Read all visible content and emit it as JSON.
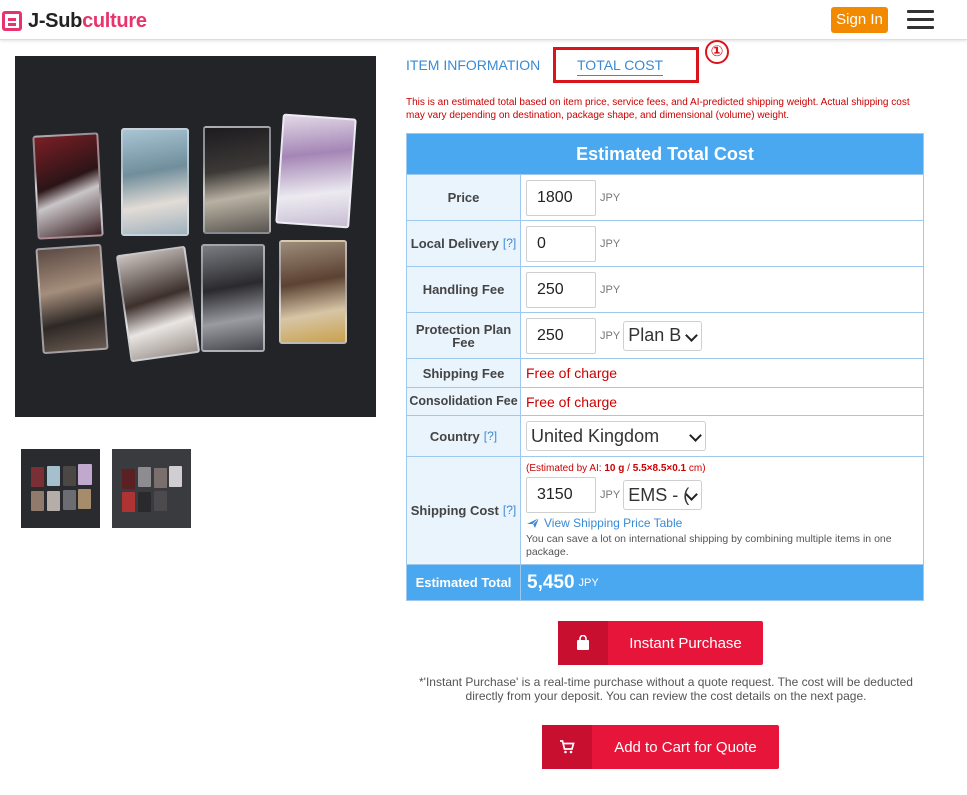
{
  "header": {
    "logo_prefix": "J-Sub",
    "logo_accent": "culture",
    "signin_label": "Sign In"
  },
  "tabs": {
    "info": "ITEM INFORMATION",
    "total": "TOTAL COST",
    "badge": "①"
  },
  "note": "This is an estimated total based on item price, service fees, and AI-predicted shipping weight. Actual shipping cost may vary depending on destination, package shape, and dimensional (volume) weight.",
  "table": {
    "title": "Estimated Total Cost",
    "help": "[?]",
    "unit": "JPY",
    "price": {
      "label": "Price",
      "value": "1800"
    },
    "local": {
      "label": "Local Delivery",
      "value": "0"
    },
    "handling": {
      "label": "Handling Fee",
      "value": "250"
    },
    "protection": {
      "label": "Protection Plan Fee",
      "value": "250",
      "plan": "Plan B"
    },
    "shipping_fee": {
      "label": "Shipping Fee",
      "value": "Free of charge"
    },
    "consolidation": {
      "label": "Consolidation Fee",
      "value": "Free of charge"
    },
    "country": {
      "label": "Country",
      "value": "United Kingdom"
    },
    "shipping_cost": {
      "label": "Shipping Cost",
      "estimate_prefix": "(Estimated by AI: ",
      "estimate_weight": "10 g",
      "estimate_sep": " / ",
      "estimate_dims": "5.5×8.5×0.1",
      "estimate_suffix": " cm)",
      "value": "3150",
      "method": "EMS - (",
      "link": "View Shipping Price Table",
      "hint": "You can save a lot on international shipping by combining multiple items in one package."
    },
    "total": {
      "label": "Estimated Total",
      "value": "5,450",
      "unit": "JPY"
    }
  },
  "buttons": {
    "instant": "Instant Purchase",
    "instant_note": "*'Instant Purchase' is a real-time purchase without a quote request. The cost will be deducted directly from your deposit. You can review the cost details on the next page.",
    "cart": "Add to Cart for Quote"
  },
  "colors": {
    "accent_blue": "#4aa8f0",
    "link_blue": "#3a8ad4",
    "brand_pink": "#e8336d",
    "signin_orange": "#f28a00",
    "button_red": "#e8153a",
    "alert_red": "#cc0000"
  }
}
